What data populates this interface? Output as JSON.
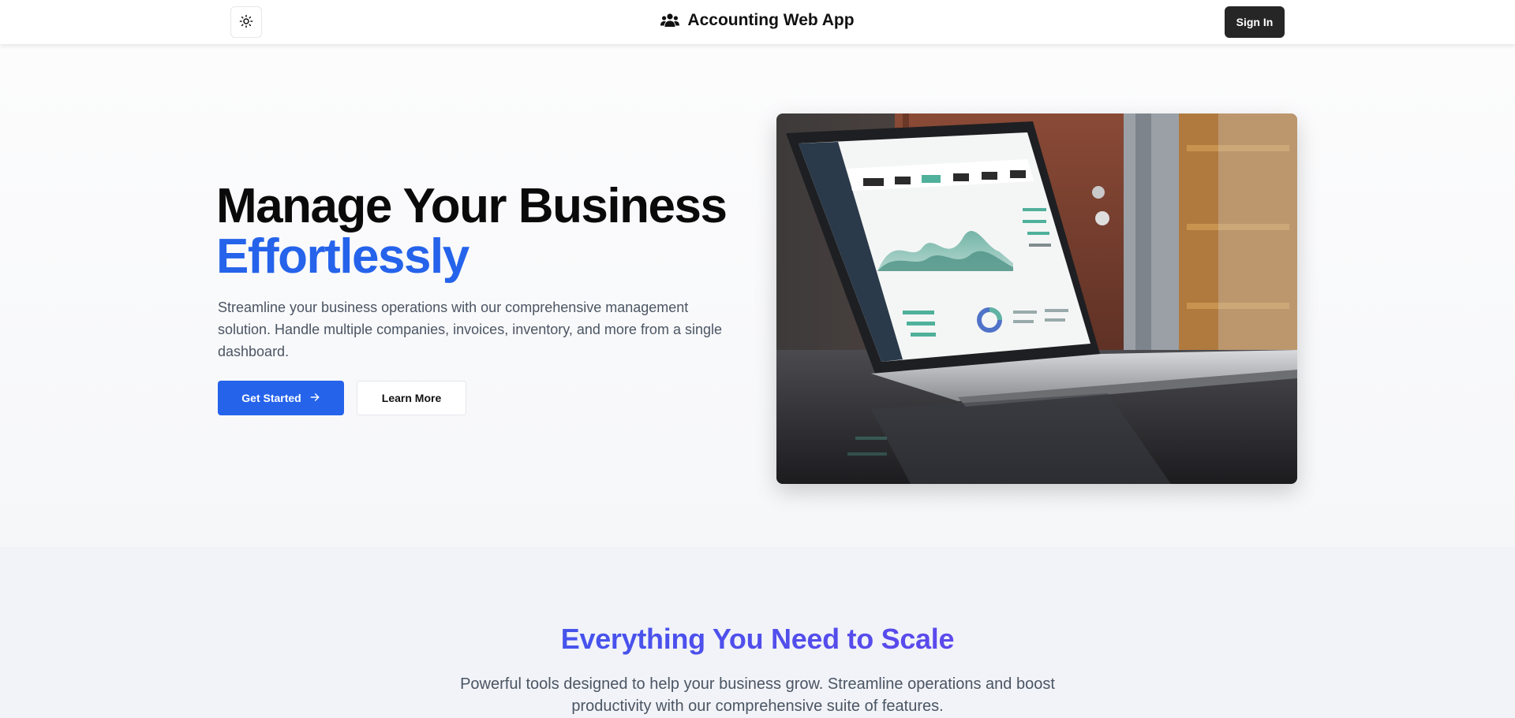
{
  "header": {
    "theme_icon": "sun-icon",
    "brand_icon": "users-icon",
    "brand_name": "Accounting Web App",
    "signin_label": "Sign In"
  },
  "hero": {
    "title_line1": "Manage Your Business",
    "title_line2": "Effortlessly",
    "description": "Streamline your business operations with our comprehensive management solution. Handle multiple companies, invoices, inventory, and more from a single dashboard.",
    "primary_button": "Get Started",
    "primary_icon": "arrow-right-icon",
    "secondary_button": "Learn More",
    "accent_color": "#2563eb"
  },
  "features": {
    "title": "Everything You Need to Scale",
    "description": "Powerful tools designed to help your business grow. Streamline operations and boost productivity with our comprehensive suite of features.",
    "gradient": [
      "#2563eb",
      "#7c3aed"
    ]
  },
  "colors": {
    "dark_button": "#262626",
    "primary": "#2563eb",
    "text_muted": "#4b5563"
  }
}
